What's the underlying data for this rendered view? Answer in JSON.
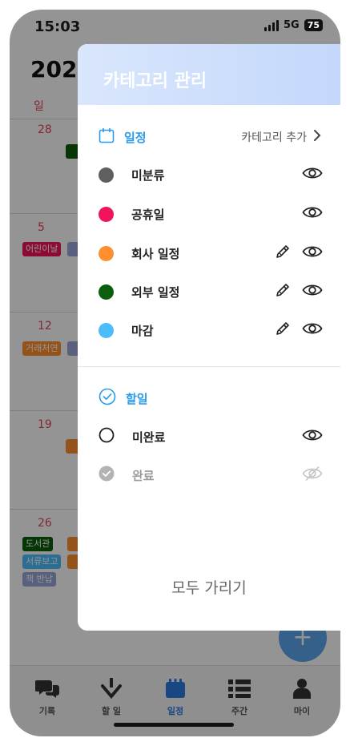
{
  "status": {
    "time": "15:03",
    "network": "5G",
    "battery": "75"
  },
  "calendar": {
    "year": "202",
    "weekday": "일",
    "weeks": [
      {
        "date": "28",
        "chips": []
      },
      {
        "date": "5",
        "chips": [
          "어린이날"
        ]
      },
      {
        "date": "12",
        "chips": [
          "거래처연"
        ]
      },
      {
        "date": "19",
        "chips": []
      },
      {
        "date": "26",
        "chips": [
          "도서관",
          "서류보고",
          "책 반납"
        ]
      }
    ]
  },
  "panel": {
    "title": "카테고리 관리",
    "schedule_section": {
      "title": "일정",
      "add_label": "카테고리 추가"
    },
    "categories": [
      {
        "label": "미분류",
        "color": "#5f5f5f",
        "editable": false
      },
      {
        "label": "공휴일",
        "color": "#f0145a",
        "editable": false
      },
      {
        "label": "회사 일정",
        "color": "#ff8f2e",
        "editable": true
      },
      {
        "label": "외부 일정",
        "color": "#0b5e0b",
        "editable": true
      },
      {
        "label": "마감",
        "color": "#4bbdfb",
        "editable": true
      }
    ],
    "todo_section": {
      "title": "할일"
    },
    "todos": [
      {
        "label": "미완료",
        "visible": true
      },
      {
        "label": "완료",
        "visible": false
      }
    ],
    "hide_all_label": "모두 가리기"
  },
  "nav": [
    {
      "label": "기록",
      "icon": "chat-bubbles-icon"
    },
    {
      "label": "할 일",
      "icon": "check-download-icon"
    },
    {
      "label": "일정",
      "icon": "calendar-icon",
      "active": true
    },
    {
      "label": "주간",
      "icon": "list-icon"
    },
    {
      "label": "마이",
      "icon": "person-icon"
    }
  ],
  "colors": {
    "accent": "#2a9bea",
    "nav_active": "#2a7be0",
    "panel_header": "#c4d8fb"
  }
}
